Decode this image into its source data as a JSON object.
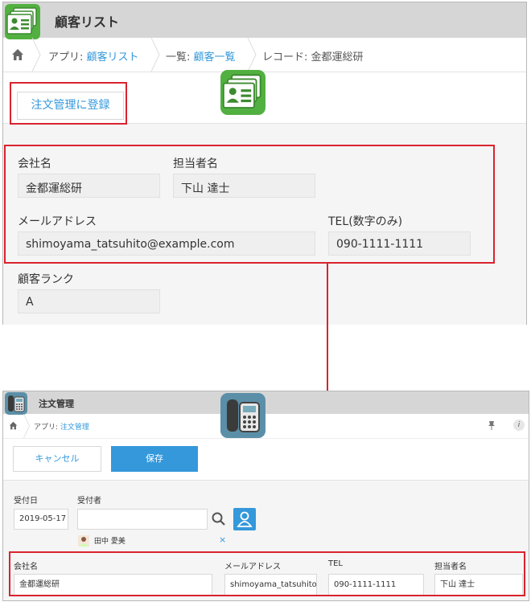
{
  "customer_app": {
    "title": "顧客リスト",
    "breadcrumb": {
      "app_prefix": "アプリ: ",
      "app_link": "顧客リスト",
      "list_prefix": "一覧: ",
      "list_link": "顧客一覧",
      "record": "レコード: 金都運総研"
    },
    "register_button": "注文管理に登録",
    "fields": {
      "company_label": "会社名",
      "company_value": "金都運総研",
      "person_label": "担当者名",
      "person_value": "下山 達士",
      "email_label": "メールアドレス",
      "email_value": "shimoyama_tatsuhito@example.com",
      "tel_label": "TEL(数字のみ)",
      "tel_value": "090-1111-1111",
      "rank_label": "顧客ランク",
      "rank_value": "A"
    }
  },
  "order_app": {
    "title": "注文管理",
    "breadcrumb": {
      "app_prefix": "アプリ: ",
      "app_link": "注文管理"
    },
    "cancel_button": "キャンセル",
    "save_button": "保存",
    "fields": {
      "received_date_label": "受付日",
      "received_date_value": "2019-05-17",
      "receiver_label": "受付者",
      "receiver_user": "田中 愛美",
      "remove_glyph": "×",
      "company_label": "会社名",
      "company_value": "金都運総研",
      "email_label": "メールアドレス",
      "email_value": "shimoyama_tatsuhito@example.com",
      "tel_label": "TEL",
      "tel_value": "090-1111-1111",
      "person_label": "担当者名",
      "person_value": "下山 達士"
    }
  },
  "colors": {
    "highlight": "#d9232e",
    "link": "#3498db",
    "header": "#d6d6d6"
  },
  "icons": [
    "home-icon",
    "customer-list-app-icon",
    "order-app-icon",
    "search-icon",
    "user-icon",
    "pin-icon",
    "info-icon",
    "remove-icon"
  ]
}
